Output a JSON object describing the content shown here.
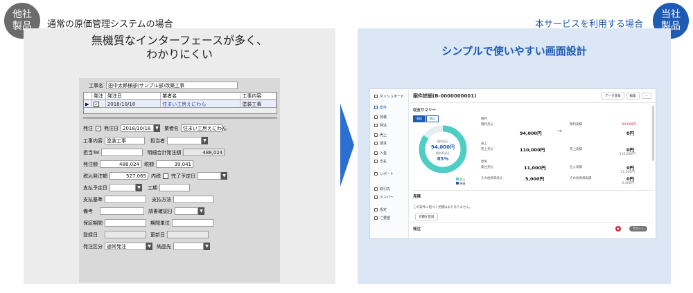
{
  "left": {
    "badge": [
      "他社",
      "製品"
    ],
    "caption": "通常の原価管理システムの場合",
    "headline": [
      "無機質なインターフェースが多く、",
      "わかりにくい"
    ],
    "form": {
      "project_label": "工事名",
      "project_value": "田中太郎様邸(サンプル邸)改築工事",
      "grid_headers": [
        "発注",
        "発注日",
        "業者名",
        "工事内容"
      ],
      "grid_row": [
        "2018/10/18",
        "住まい工房えにわん",
        "塗装工事"
      ],
      "order_label": "発注",
      "order_date_label": "発注日",
      "order_date": "2018/10/18",
      "vendor_label": "業者名",
      "vendor": "住まい工房えにわん",
      "work_label": "工事内容",
      "work_value": "塗装工事",
      "staff_label": "担当者",
      "tel_label": "担当Tel",
      "total_label": "明細合計発注額",
      "total_value": "488,024",
      "amount_label": "発注額",
      "amount_value": "488,024",
      "tax_label": "税額",
      "tax_value": "39,041",
      "taxin_label": "税込発注額",
      "taxin_value": "527,065",
      "inner_label": "内税",
      "done_label": "完了予定日",
      "pay_date_label": "支払予定日",
      "period_label": "工期",
      "pay_basis_label": "支払基準",
      "pay_method_label": "支払方法",
      "note_label": "備考",
      "confirm_label": "請書確認日",
      "warranty_label": "保証期間",
      "unit_label": "期間単位",
      "reg_label": "登録日",
      "upd_label": "更新日",
      "type_label": "発注区分",
      "type_value": "通常発注",
      "pay_to_label": "納品先"
    }
  },
  "right": {
    "badge": [
      "当社",
      "製品"
    ],
    "caption": "本サービスを利用する場合",
    "headline": "シンプルで使いやすい画面設計",
    "app": {
      "sidebar": [
        "ダッシュボード",
        "案件",
        "見積",
        "発注",
        "売上",
        "請求",
        "入金",
        "支払",
        "レポート",
        "取引先",
        "メンバー",
        "設定",
        "ご要望"
      ],
      "title": "案件詳細(B-0000000001)",
      "btn_data": "データ登録",
      "btn_edit": "編集",
      "summary_title": "収支サマリー",
      "tabs": [
        "税抜",
        "税込"
      ],
      "donut_label1": "粗利見込",
      "donut_value": "94,000円",
      "donut_label2": "粗利率見込",
      "donut_pct": "85%",
      "legend": [
        "売上",
        "原価"
      ],
      "profit_label": "粗利",
      "profit_sub": "粗利見込",
      "profit_value": "94,000円",
      "profit_actual_label": "粗利実績",
      "profit_actual_value": "0円",
      "profit_badge": "-94,000円",
      "sales_label": "売上",
      "sales_sub": "売上見込",
      "sales_value": "110,000円",
      "sales_actual_label": "売上実績",
      "sales_actual_value": "0円",
      "sales_actual_note": "-110,000円",
      "cost_label": "原価",
      "cost_sub1": "発注見込",
      "cost_value1": "11,000円",
      "cost_sub2": "その他原価見込",
      "cost_value2": "5,000円",
      "cost_actual_label1": "仕入実績",
      "cost_actual_value1": "0円",
      "cost_actual_note1": "-11,000円",
      "cost_actual_label2": "その他原価実績",
      "cost_actual_value2": "0円",
      "cost_actual_note2": "-5,000円",
      "funds_title": "見積",
      "funds_text": "この案件に紐づく見積はまだありません。",
      "funds_btn": "見積を登録",
      "order_title": "発注",
      "help_text": "サポート"
    },
    "colors": {
      "accent": "#1f5bb5",
      "donut": "#4ecdc4"
    }
  }
}
